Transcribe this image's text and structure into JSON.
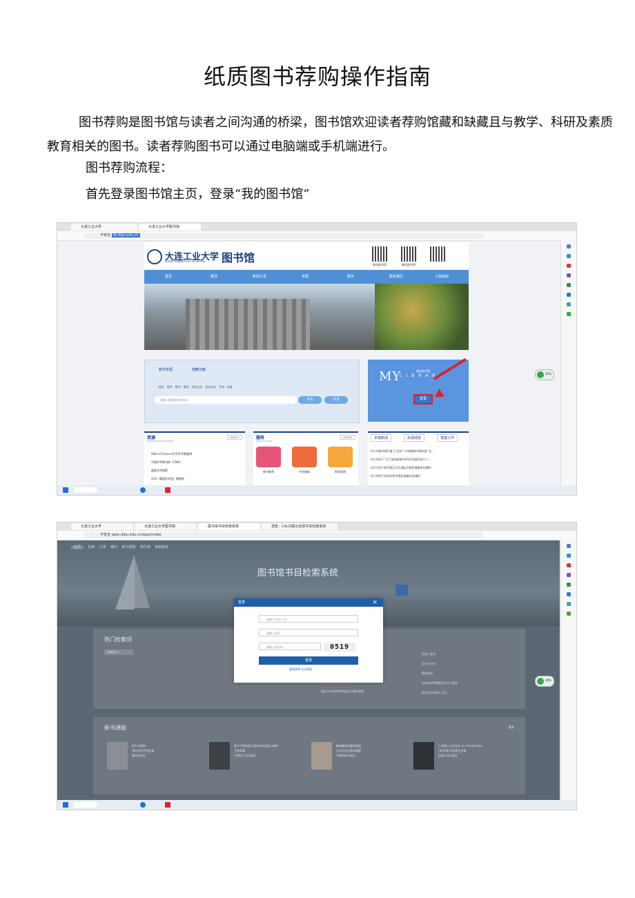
{
  "document": {
    "title": "纸质图书荐购操作指南",
    "paragraph1": "图书荐购是图书馆与读者之间沟通的桥梁，图书馆欢迎读者荐购馆藏和缺藏且与教学、科研及素质教育相关的图书。读者荐购图书可以通过电脑端或手机端进行。",
    "paragraph2": "图书荐购流程：",
    "paragraph3": "首先登录图书馆主页，登录“我的图书馆”"
  },
  "screenshot1": {
    "tabs": [
      "大连工业大学",
      "大连工业大学图书馆"
    ],
    "address_prefix": "不安全",
    "address": "lib.dlpu.edu.cn",
    "logo_text": "大连工业大学",
    "logo_sub": "Dalian Polytechnic University",
    "logo_library": "图书馆",
    "qr_labels": [
      "移动图书馆",
      "微信图书馆",
      ""
    ],
    "nav": [
      "首页",
      "概况",
      "新闻公告",
      "资源",
      "服务",
      "联系我们",
      "入馆指南"
    ],
    "search_tabs": [
      "数字资源",
      "馆藏文献"
    ],
    "search_filters": [
      "知识",
      "图书",
      "期刊",
      "报纸",
      "学位论文",
      "会议论文",
      "专利",
      "标准"
    ],
    "search_placeholder": "请输入需要查找的内容...",
    "btn_chinese": "中文",
    "btn_foreign": "外文",
    "my_library_big": "MY",
    "my_library_small": "LIBRARY",
    "my_library_cn": "我的图书馆",
    "login_button": "登录",
    "resources_title": "资源",
    "resources_sub": "RESOURCES NAVIGATION",
    "resources_more": "more+",
    "resources": [
      "Web of Science平台SCIE数据库",
      "中国学术期刊网（CNKI）",
      "超星学术搜索",
      "ACS（美国化学会）数据库"
    ],
    "services_title": "服务",
    "services_sub": "SERVICE GUIDE",
    "services_more": "more+",
    "services": [
      "新书推荐",
      "书刊借阅",
      "检序咨询"
    ],
    "news_tabs": [
      "本馆新闻",
      "资源动态",
      "党建工作"
    ],
    "news": [
      "03-29图书馆开展“汇文杯—付梓飘香书馆系统”活...",
      "03-28关于“辽宁省高校图书2022年度先进个人...",
      "03-10关于图书馆正式开通云文献传递服务的通知",
      "02-28关于如何在图书馆自助借还的通知"
    ],
    "badge": "31%"
  },
  "screenshot2": {
    "tabs": [
      "大连工业大学",
      "大连工业大学图书馆",
      "图书馆书目检索系统",
      "调查：CALIS联合目录共享检索系统"
    ],
    "address_prefix": "不安全",
    "address": "opac.dlpu.edu.cn/opac/index",
    "nav": [
      "首页",
      "检索",
      "分类",
      "期刊",
      "新书通报",
      "排行榜",
      "读者服务"
    ],
    "title": "图书馆书目检索系统",
    "modal_title": "登录",
    "modal_close": "×",
    "field_user": "请输入学号/工号",
    "field_pass": "请输入密码",
    "field_code": "请输入验证码",
    "captcha": "0519",
    "login_btn": "登录",
    "links": "登录说明  忘记密码",
    "hot_title": "热门检索词",
    "hot_chip": "机械设计 7",
    "hot_items": [
      "EDA-arduino电路教程设计与应用教程",
      "电路原理及设计与应用",
      "电路原理实验设计与分析",
      "酒店CorelDRAW电路设计基础教程",
      "文化人类学",
      "设计与文化",
      "服装构造",
      "生物化学简明教程与学习指导",
      "数学分析的若干方法"
    ],
    "new_title": "新书通报",
    "more": "更多",
    "books": [
      {
        "line1": "权力与服饰",
        "line2": "(美)迪特·萨迪亚著",
        "line3": "重庆出版社"
      },
      {
        "line1": "基于中等有限元理论的多层板与结构",
        "line2": "王梅等著",
        "line3": "中国轻工业出版社"
      },
      {
        "line1": "糖和糖尿病膳食指南",
        "line2": "日本文化出版局编著",
        "line3": "中国纺织出版社"
      },
      {
        "line1": "人机融入自主导论 an introduction",
        "line2": "[英]约翰·克里斯托夫著",
        "line3": "机械工业出版社"
      }
    ],
    "badge": "30%"
  }
}
